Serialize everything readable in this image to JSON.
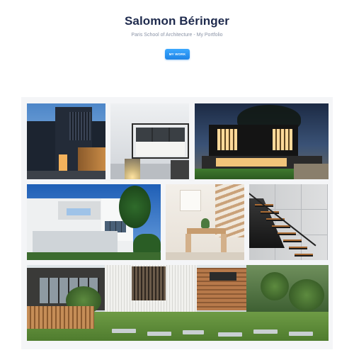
{
  "header": {
    "title": "Salomon Béringer",
    "subtitle": "Paris School of Architecture - My Portfolio",
    "cta_label": "MY WORK"
  },
  "colors": {
    "title": "#1e2a4d",
    "subtitle": "#8a93a6",
    "accent": "#1f84e6",
    "gallery_bg": "#f4f5f7"
  },
  "gallery": {
    "photos": [
      {
        "name": "photo-dark-slatted-facade"
      },
      {
        "name": "photo-white-facade-window"
      },
      {
        "name": "photo-night-modern-house"
      },
      {
        "name": "photo-white-villa"
      },
      {
        "name": "photo-interior-dining"
      },
      {
        "name": "photo-floating-staircase"
      },
      {
        "name": "photo-garden-facade"
      }
    ]
  }
}
